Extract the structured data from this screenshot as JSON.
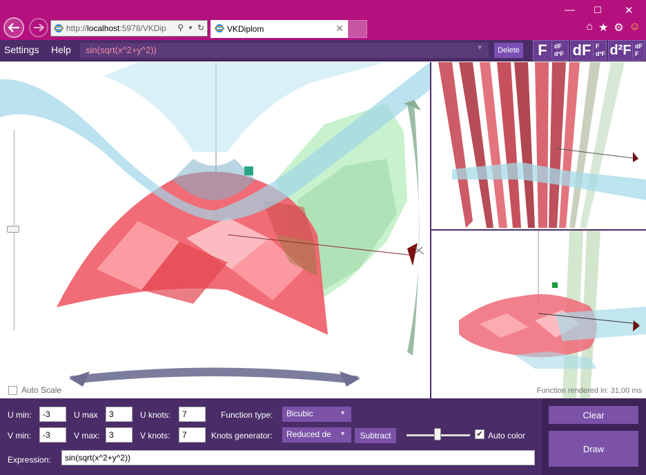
{
  "browser": {
    "address_scheme": "http://",
    "address_host": "localhost",
    "address_rest": ":5978/VKDip",
    "tab_title": "VKDiplom"
  },
  "menu": {
    "settings": "Settings",
    "help": "Help"
  },
  "function_selector": {
    "value": "sin(sqrt(x^2+y^2))"
  },
  "delete_button": "Delete",
  "derivative_buttons": [
    {
      "main": "F",
      "small_top": "dF",
      "small_bottom": "d²F"
    },
    {
      "main": "dF",
      "small_top": "F",
      "small_bottom": "d²F"
    },
    {
      "main": "d²F",
      "small_top": "dF",
      "small_bottom": "F"
    }
  ],
  "viewport": {
    "auto_scale_label": "Auto Scale",
    "auto_scale_checked": false,
    "render_time": "Function rendered in: 31,00 ms"
  },
  "controls": {
    "u_min_label": "U min:",
    "u_min": "-3",
    "u_max_label": "U max",
    "u_max": "3",
    "u_knots_label": "U knots:",
    "u_knots": "7",
    "v_min_label": "V min:",
    "v_min": "-3",
    "v_max_label": "V max:",
    "v_max": "3",
    "v_knots_label": "V knots:",
    "v_knots": "7",
    "function_type_label": "Function type:",
    "function_type": "Bicubic",
    "knots_generator_label": "Knots generator:",
    "knots_generator": "Reduced de",
    "subtract_button": "Subtract",
    "auto_color_label": "Auto color",
    "auto_color_checked": true,
    "expression_label": "Expression:",
    "expression": "sin(sqrt(x^2+y^2))"
  },
  "actions": {
    "clear": "Clear",
    "draw": "Draw"
  },
  "colors": {
    "chrome": "#b4117e",
    "app": "#4a2d68",
    "accent": "#7b52a8",
    "surface_red": "#f0606a",
    "surface_blue": "#9fd6e8",
    "surface_green": "#a9e6b0"
  }
}
